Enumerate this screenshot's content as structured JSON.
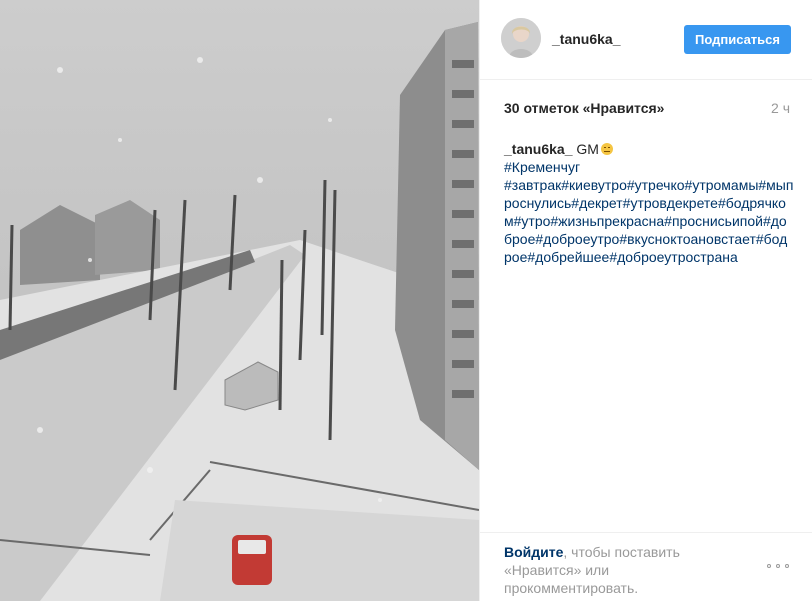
{
  "post": {
    "author": "_tanu6ka_",
    "follow_label": "Подписаться",
    "likes_text": "30 отметок «Нравится»",
    "time_text": "2 ч",
    "caption_user": "_tanu6ka_",
    "caption_text": "GM",
    "caption_hashtags": "#Кременчуг\n#завтрак#киевутро#утречко#утромамы#мыпроснулись#декрет#утровдекрете#бодрячком#утро#жизньпрекрасна#проснисьипой#доброе#доброеутро#вкусноктоановстает#бодрое#добрейшее#доброеутространа",
    "emoji_icon": "confused-face-icon",
    "photo_description_icon": "snowy-street-photo"
  },
  "footer": {
    "login_link": "Войдите",
    "login_rest": ", чтобы поставить «Нравится» или прокомментировать.",
    "more_icon": "more-options-icon"
  },
  "colors": {
    "accent": "#3897f0",
    "link": "#003569",
    "muted": "#999999",
    "text": "#262626"
  }
}
